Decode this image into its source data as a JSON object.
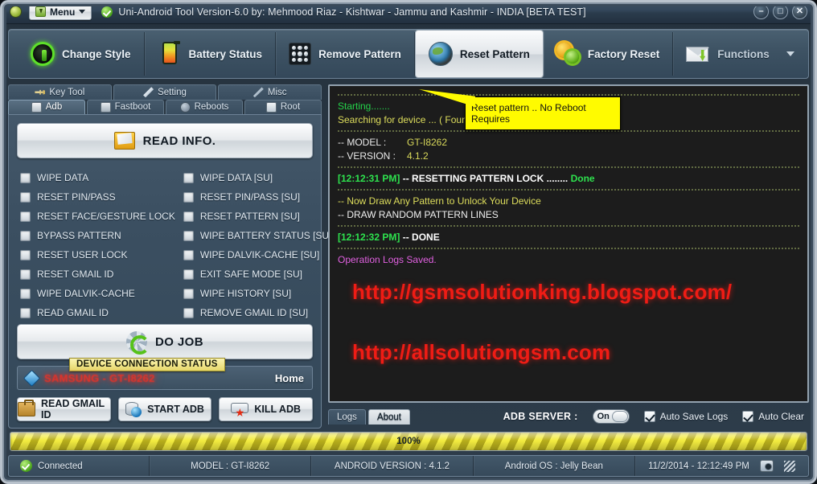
{
  "window": {
    "menu_label": "Menu",
    "title": "Uni-Android Tool Version-6.0 by: Mehmood Riaz - Kishtwar - Jammu and Kashmir - INDIA   [BETA TEST]",
    "minimize": "–",
    "maximize": "□",
    "close": "✕"
  },
  "toolbar": {
    "items": [
      {
        "label": "Change Style",
        "icon": "style-orb-icon",
        "active": false
      },
      {
        "label": "Battery Status",
        "icon": "battery-icon",
        "active": false
      },
      {
        "label": "Remove Pattern",
        "icon": "pattern-grid-icon",
        "active": false
      },
      {
        "label": "Reset Pattern",
        "icon": "globe-rock-icon",
        "active": true
      },
      {
        "label": "Factory Reset",
        "icon": "gears-icon",
        "active": false
      },
      {
        "label": "Functions",
        "icon": "mail-download-icon",
        "active": false
      }
    ]
  },
  "left_panel": {
    "tabs_top": [
      {
        "label": "Key Tool",
        "icon": "key-icon",
        "selected": false
      },
      {
        "label": "Setting",
        "icon": "tools-icon",
        "selected": false
      },
      {
        "label": "Misc",
        "icon": "pen-icon",
        "selected": false
      }
    ],
    "tabs_bottom": [
      {
        "label": "Adb",
        "icon": "adb-icon",
        "selected": true
      },
      {
        "label": "Fastboot",
        "icon": "fastboot-icon",
        "selected": false
      },
      {
        "label": "Reboots",
        "icon": "reboots-icon",
        "selected": false
      },
      {
        "label": "Root",
        "icon": "root-icon",
        "selected": false
      }
    ],
    "read_info_button": "READ INFO.",
    "checkboxes_left": [
      {
        "label": "WIPE DATA",
        "checked": false
      },
      {
        "label": "RESET PIN/PASS",
        "checked": false
      },
      {
        "label": "RESET FACE/GESTURE LOCK",
        "checked": false
      },
      {
        "label": "BYPASS PATTERN",
        "checked": false
      },
      {
        "label": "RESET USER LOCK",
        "checked": false
      },
      {
        "label": "RESET GMAIL ID",
        "checked": false
      },
      {
        "label": "WIPE DALVIK-CACHE",
        "checked": false
      },
      {
        "label": "READ GMAIL ID",
        "checked": false
      }
    ],
    "checkboxes_right": [
      {
        "label": "WIPE DATA [SU]",
        "checked": false
      },
      {
        "label": "RESET PIN/PASS [SU]",
        "checked": false
      },
      {
        "label": "RESET PATTERN [SU]",
        "checked": false
      },
      {
        "label": "WIPE BATTERY STATUS [SU]",
        "checked": false
      },
      {
        "label": "WIPE DALVIK-CACHE [SU]",
        "checked": false
      },
      {
        "label": "EXIT SAFE MODE [SU]",
        "checked": false
      },
      {
        "label": "WIPE HISTORY [SU]",
        "checked": false
      },
      {
        "label": "REMOVE GMAIL ID [SU]",
        "checked": false
      }
    ],
    "do_job_button": "DO JOB",
    "device_status_tooltip": "DEVICE CONNECTION STATUS",
    "device_name": "SAMSUNG - GT-I8262",
    "home_label": "Home",
    "action_buttons": [
      {
        "label": "READ GMAIL ID",
        "icon": "briefcase-icon"
      },
      {
        "label": "START ADB",
        "icon": "database-globe-icon"
      },
      {
        "label": "KILL ADB",
        "icon": "kill-adb-icon"
      }
    ]
  },
  "console": {
    "callout": "Reset pattern .. No Reboot Requires",
    "lines": [
      {
        "type": "sep"
      },
      {
        "type": "text",
        "color": "green",
        "text": "Starting......."
      },
      {
        "type": "text",
        "color": "yellow",
        "text": "Searching for device ...     ( Found )"
      },
      {
        "type": "sep"
      },
      {
        "type": "kv",
        "key": "--  MODEL    :",
        "value": "GT-I8262"
      },
      {
        "type": "kv",
        "key": "--  VERSION  :",
        "value": "4.1.2"
      },
      {
        "type": "sep"
      },
      {
        "type": "result",
        "ts": "[12:12:31 PM]",
        "dash": "--",
        "text": "RESETTING PATTERN LOCK ........",
        "status": "Done"
      },
      {
        "type": "sep"
      },
      {
        "type": "text",
        "color": "yellow",
        "text": "--  Now Draw Any Pattern to Unlock Your Device"
      },
      {
        "type": "text",
        "color": "white",
        "text": "--  DRAW RANDOM PATTERN LINES"
      },
      {
        "type": "sep"
      },
      {
        "type": "result",
        "ts": "[12:12:32 PM]",
        "dash": "--",
        "text": "DONE",
        "status": ""
      },
      {
        "type": "sep"
      },
      {
        "type": "text",
        "color": "magenta",
        "text": "Operation Logs Saved."
      }
    ],
    "url1": "http://gsmsolutionking.blogspot.com/",
    "url2": "http://allsolutiongsm.com",
    "bottom_tabs": [
      {
        "label": "Logs",
        "selected": false
      },
      {
        "label": "About",
        "selected": true
      }
    ],
    "adb_server_label": "ADB SERVER :",
    "adb_server_state": "On",
    "auto_save_logs": "Auto Save Logs",
    "auto_clear": "Auto Clear"
  },
  "progress": {
    "percent_label": "100%",
    "value": 100
  },
  "status_bar": {
    "connection": "Connected",
    "model": "MODEL : GT-I8262",
    "android_version": "ANDROID VERSION : 4.1.2",
    "os": "Android OS : Jelly Bean",
    "datetime": "11/2/2014  -  12:12:49 PM"
  },
  "colors": {
    "accent_yellow": "#fffb00",
    "url_red": "#ef1c15",
    "log_green": "#2ee24e",
    "log_yellow": "#dede5c",
    "log_magenta": "#e060e0",
    "panel_blue": "#3b4f61"
  }
}
